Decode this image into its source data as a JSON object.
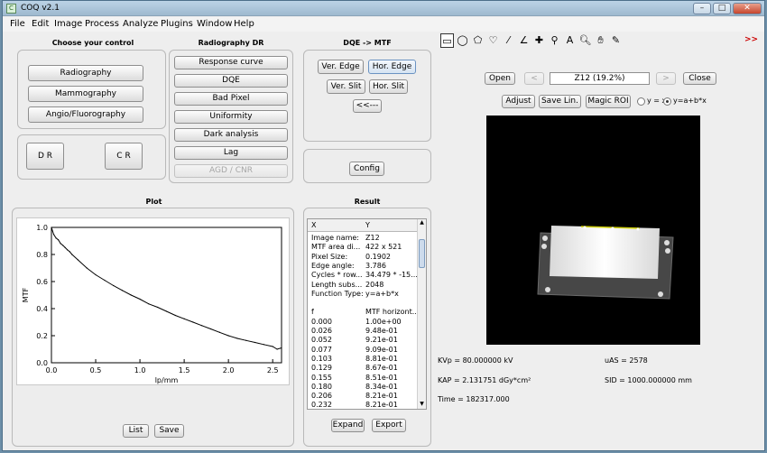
{
  "window": {
    "title": "COQ  v2.1",
    "btn_min": "–",
    "btn_max": "□",
    "btn_close": "✕"
  },
  "menu": [
    "File",
    "Edit",
    "Image",
    "Process",
    "Analyze",
    "Plugins",
    "Window",
    "Help"
  ],
  "choose": {
    "title": "Choose your control",
    "radiography": "Radiography",
    "mammography": "Mammography",
    "angio": "Angio/Fluorography",
    "dr": "D R",
    "cr": "C R"
  },
  "radiography_dr": {
    "title": "Radiography DR",
    "buttons": [
      "Response curve",
      "DQE",
      "Bad Pixel",
      "Uniformity",
      "Dark analysis",
      "Lag",
      "AGD / CNR"
    ]
  },
  "dqe_mtf": {
    "title": "DQE -> MTF",
    "ver_edge": "Ver. Edge",
    "hor_edge": "Hor. Edge",
    "ver_slit": "Ver. Slit",
    "hor_slit": "Hor. Slit",
    "back": "<<---",
    "config": "Config"
  },
  "plot": {
    "title": "Plot",
    "list": "List",
    "save": "Save"
  },
  "chart_data": {
    "type": "line",
    "title": "",
    "xlabel": "lp/mm",
    "ylabel": "MTF",
    "xlim": [
      0,
      2.6
    ],
    "ylim": [
      0,
      1.0
    ],
    "xticks": [
      "0.0",
      "0.5",
      "1.0",
      "1.5",
      "2.0",
      "2.5"
    ],
    "yticks": [
      "0.0",
      "0.2",
      "0.4",
      "0.6",
      "0.8",
      "1.0"
    ],
    "x": [
      0,
      0.026,
      0.052,
      0.077,
      0.103,
      0.129,
      0.155,
      0.18,
      0.206,
      0.232,
      0.3,
      0.4,
      0.5,
      0.6,
      0.7,
      0.8,
      0.9,
      1.0,
      1.1,
      1.2,
      1.3,
      1.4,
      1.5,
      1.6,
      1.7,
      1.8,
      1.9,
      2.0,
      2.1,
      2.2,
      2.3,
      2.4,
      2.5,
      2.55,
      2.6
    ],
    "y": [
      1.0,
      0.948,
      0.921,
      0.909,
      0.881,
      0.867,
      0.851,
      0.834,
      0.821,
      0.8,
      0.76,
      0.7,
      0.65,
      0.61,
      0.57,
      0.535,
      0.5,
      0.47,
      0.435,
      0.41,
      0.38,
      0.35,
      0.325,
      0.3,
      0.275,
      0.25,
      0.225,
      0.2,
      0.18,
      0.165,
      0.15,
      0.135,
      0.12,
      0.1,
      0.11
    ]
  },
  "result": {
    "title": "Result",
    "col_x": "X",
    "col_y": "Y",
    "rows": [
      [
        "Image name:",
        "Z12"
      ],
      [
        "MTF area di...",
        "422 x 521"
      ],
      [
        "Pixel Size:",
        "0.1902"
      ],
      [
        "Edge angle:",
        "3.786"
      ],
      [
        "Cycles * row...",
        "34.479 * -15...."
      ],
      [
        "Length subs...",
        "2048"
      ],
      [
        "Function Type:",
        "y=a+b*x"
      ],
      [
        "",
        ""
      ],
      [
        "f",
        "MTF horizont..."
      ],
      [
        "0.000",
        "1.00e+00"
      ],
      [
        "0.026",
        "9.48e-01"
      ],
      [
        "0.052",
        "9.21e-01"
      ],
      [
        "0.077",
        "9.09e-01"
      ],
      [
        "0.103",
        "8.81e-01"
      ],
      [
        "0.129",
        "8.67e-01"
      ],
      [
        "0.155",
        "8.51e-01"
      ],
      [
        "0.180",
        "8.34e-01"
      ],
      [
        "0.206",
        "8.21e-01"
      ],
      [
        "0.232",
        "8.21e-01"
      ]
    ],
    "expand": "Expand",
    "export": "Export"
  },
  "viewer": {
    "open": "Open",
    "prev": "<",
    "image_label": "Z12 (19.2%)",
    "next": ">",
    "close": "Close",
    "adjust": "Adjust",
    "save_lin": "Save Lin.",
    "magic_roi": "Magic ROI",
    "radio1": "y = x",
    "radio2": "y=a+b*x"
  },
  "info": {
    "kvp": "KVp = 80.000000 kV",
    "uas": "uAS = 2578",
    "kap": "KAP = 2.131751 dGy*cm²",
    "sid": "SID = 1000.000000 mm",
    "time": "Time = 182317.000"
  },
  "toolbar": {
    "more": ">>"
  }
}
